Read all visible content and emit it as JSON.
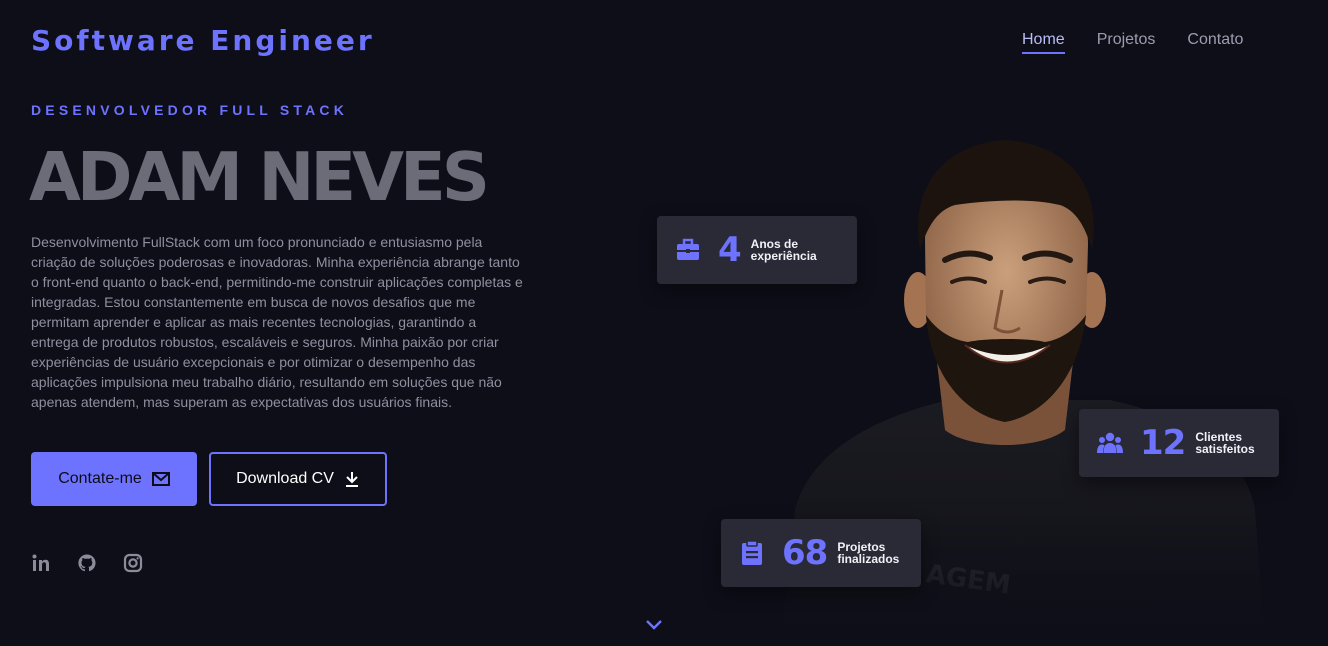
{
  "header": {
    "brand": "Software Engineer",
    "nav": [
      "Home",
      "Projetos",
      "Contato"
    ]
  },
  "hero": {
    "eyebrow": "DESENVOLVEDOR FULL STACK",
    "name": "ADAM NEVES",
    "bio": "Desenvolvimento FullStack com um foco pronunciado e entusiasmo pela criação de soluções poderosas e inovadoras. Minha experiência abrange tanto o front-end quanto o back-end, permitindo-me construir aplicações completas e integradas. Estou constantemente em busca de novos desafios que me permitam aprender e aplicar as mais recentes tecnologias, garantindo a entrega de produtos robustos, escaláveis e seguros. Minha paixão por criar experiências de usuário excepcionais e por otimizar o desempenho das aplicações impulsiona meu trabalho diário, resultando em soluções que não apenas atendem, mas superam as expectativas dos usuários finais.",
    "contact_button": "Contate-me",
    "download_button": "Download CV"
  },
  "stats": {
    "experience": {
      "value": "4",
      "label": "Anos de experiência"
    },
    "clients": {
      "value": "12",
      "label": "Clientes satisfeitos"
    },
    "projects": {
      "value": "68",
      "label": "Projetos finalizados"
    }
  },
  "social_icons": [
    "linkedin-icon",
    "github-icon",
    "instagram-icon"
  ],
  "colors": {
    "accent": "#6e73ff",
    "background": "#0e0e19",
    "card": "#2a2a36"
  }
}
